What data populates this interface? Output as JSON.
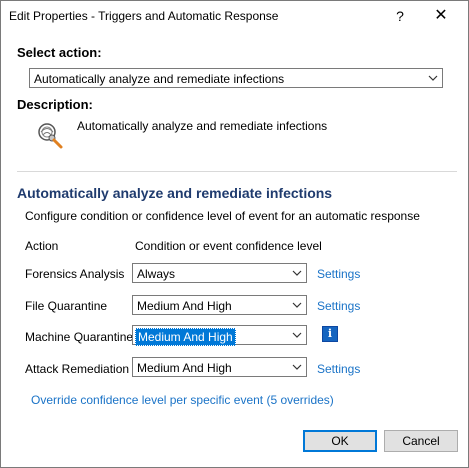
{
  "window": {
    "title": "Edit Properties - Triggers and Automatic Response",
    "help_glyph": "?",
    "close_glyph": "✕"
  },
  "select_action": {
    "label": "Select action:",
    "value": "Automatically analyze and remediate infections"
  },
  "description": {
    "label": "Description:",
    "icon": "magnifier-scan-icon",
    "text": "Automatically analyze and remediate infections"
  },
  "group": {
    "header": "Automatically analyze and remediate infections",
    "subtitle": "Configure condition or confidence level of event for an automatic response",
    "col_action": "Action",
    "col_condition": "Condition or event confidence level"
  },
  "rows": [
    {
      "action": "Forensics Analysis",
      "condition": "Always",
      "link": "Settings"
    },
    {
      "action": "File Quarantine",
      "condition": "Medium And High",
      "link": "Settings"
    },
    {
      "action": "Machine Quarantine",
      "condition": "Medium And High",
      "info": "i"
    },
    {
      "action": "Attack Remediation",
      "condition": "Medium And High",
      "link": "Settings"
    }
  ],
  "override_link": "Override confidence level per specific event (5 overrides)",
  "buttons": {
    "ok": "OK",
    "cancel": "Cancel"
  },
  "colors": {
    "accent": "#0078d7",
    "link": "#1a73c7",
    "header": "#1f3b6e"
  }
}
